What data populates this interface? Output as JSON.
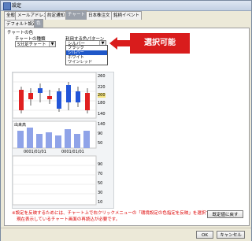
{
  "window": {
    "title": "設定"
  },
  "tabs_row1": [
    {
      "label": "全般"
    },
    {
      "label": "メールアドレス"
    },
    {
      "label": "約定通知"
    },
    {
      "label": "チャート"
    },
    {
      "label": "日本株注文"
    },
    {
      "label": "銘柄イベント"
    }
  ],
  "tabs_row2": [
    {
      "label": "デフォルト設定"
    },
    {
      "label": "色"
    }
  ],
  "section": {
    "title": "チャートの色"
  },
  "chart_type": {
    "label": "チャートの種類",
    "value": "5分足チャート"
  },
  "color_pattern": {
    "label": "利用する色パターン",
    "value": "シルバー",
    "options": [
      "ブラック",
      "シルバー",
      "ホワイト",
      "ワインレッド"
    ],
    "selected_index": 1
  },
  "callout": {
    "text": "選択可能"
  },
  "preview": {
    "price_ticks": [
      "260",
      "220",
      "200",
      "180",
      "140"
    ],
    "volume_label": "出来高",
    "volume_ticks": [
      "140",
      "90",
      "50"
    ],
    "date_labels": [
      "0001/01/01",
      "0001/01/01"
    ],
    "osc_ticks": [
      "90",
      "70",
      "50",
      "30",
      "10"
    ]
  },
  "footer": {
    "note_line1": "※設定を反映するためには、チャート上で右クリックメニューの「環境設定の色指定を反映」を選択するか、",
    "note_line2": "現在表示しているチャート画面の再読込が必要です。",
    "reset_label": "既定値に戻す",
    "ok_label": "OK",
    "cancel_label": "キャンセル"
  },
  "colors": {
    "accent": "#d91c1c",
    "selected": "#1f57c8",
    "up": "#e02020",
    "down": "#2255d8",
    "volume": "#8fa3e8"
  }
}
